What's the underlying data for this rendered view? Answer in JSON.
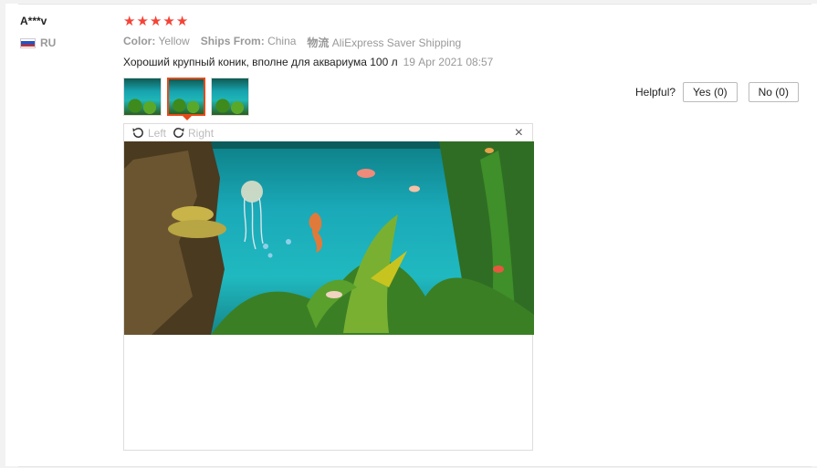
{
  "review": {
    "user": "A***v",
    "country": "RU",
    "rating": 5,
    "attributes": {
      "color_label": "Color:",
      "color_value": "Yellow",
      "ships_label": "Ships From:",
      "ships_value": "China",
      "shipping_label": "物流",
      "shipping_value": "AliExpress Saver Shipping"
    },
    "text": "Хороший крупный коник, вполне для аквариума 100 л",
    "date": "19 Apr 2021 08:57",
    "thumbnail_count": 3,
    "active_thumbnail": 2
  },
  "helpful": {
    "label": "Helpful?",
    "yes": "Yes (0)",
    "no": "No (0)"
  },
  "viewer": {
    "rotate_left": "Left",
    "rotate_right": "Right",
    "close": "×"
  },
  "icons": {
    "star": "★",
    "rotate_left": "rotate-left-icon",
    "rotate_right": "rotate-right-icon",
    "close": "close-icon"
  },
  "colors": {
    "star": "#f44336",
    "active_thumb_border": "#e64a19",
    "water": "#1fb6b6"
  }
}
